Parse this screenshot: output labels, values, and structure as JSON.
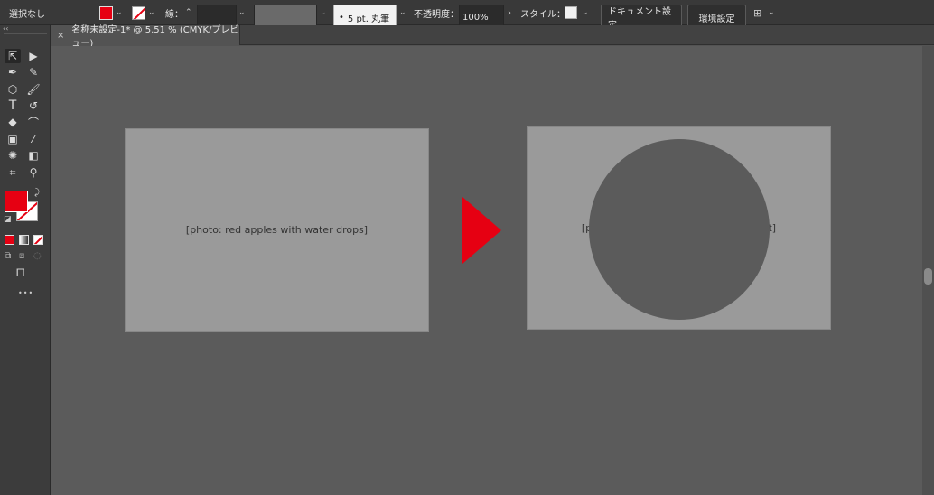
{
  "control_bar": {
    "selection_status": "選択なし",
    "stroke_label": "線：",
    "brush_label": "5 pt. 丸筆",
    "opacity_label": "不透明度：",
    "opacity_value": "100%",
    "style_label": "スタイル：",
    "doc_settings_button": "ドキュメント設定",
    "preferences_button": "環境設定",
    "fill_color": "#e60012",
    "stroke_color": "#e60012"
  },
  "tab": {
    "title": "名称未設定-1* @ 5.51 % (CMYK/プレビュー)",
    "close_glyph": "×"
  },
  "toolbar": {
    "collapse_glyph": "‹‹",
    "more_glyph": "•••",
    "fill_color": "#e60012"
  },
  "canvas": {
    "arrow_color": "#e60012",
    "left_image_label": "[photo: red apples with water drops]",
    "right_image_label": "[photo: red apples with circular cutout]"
  }
}
